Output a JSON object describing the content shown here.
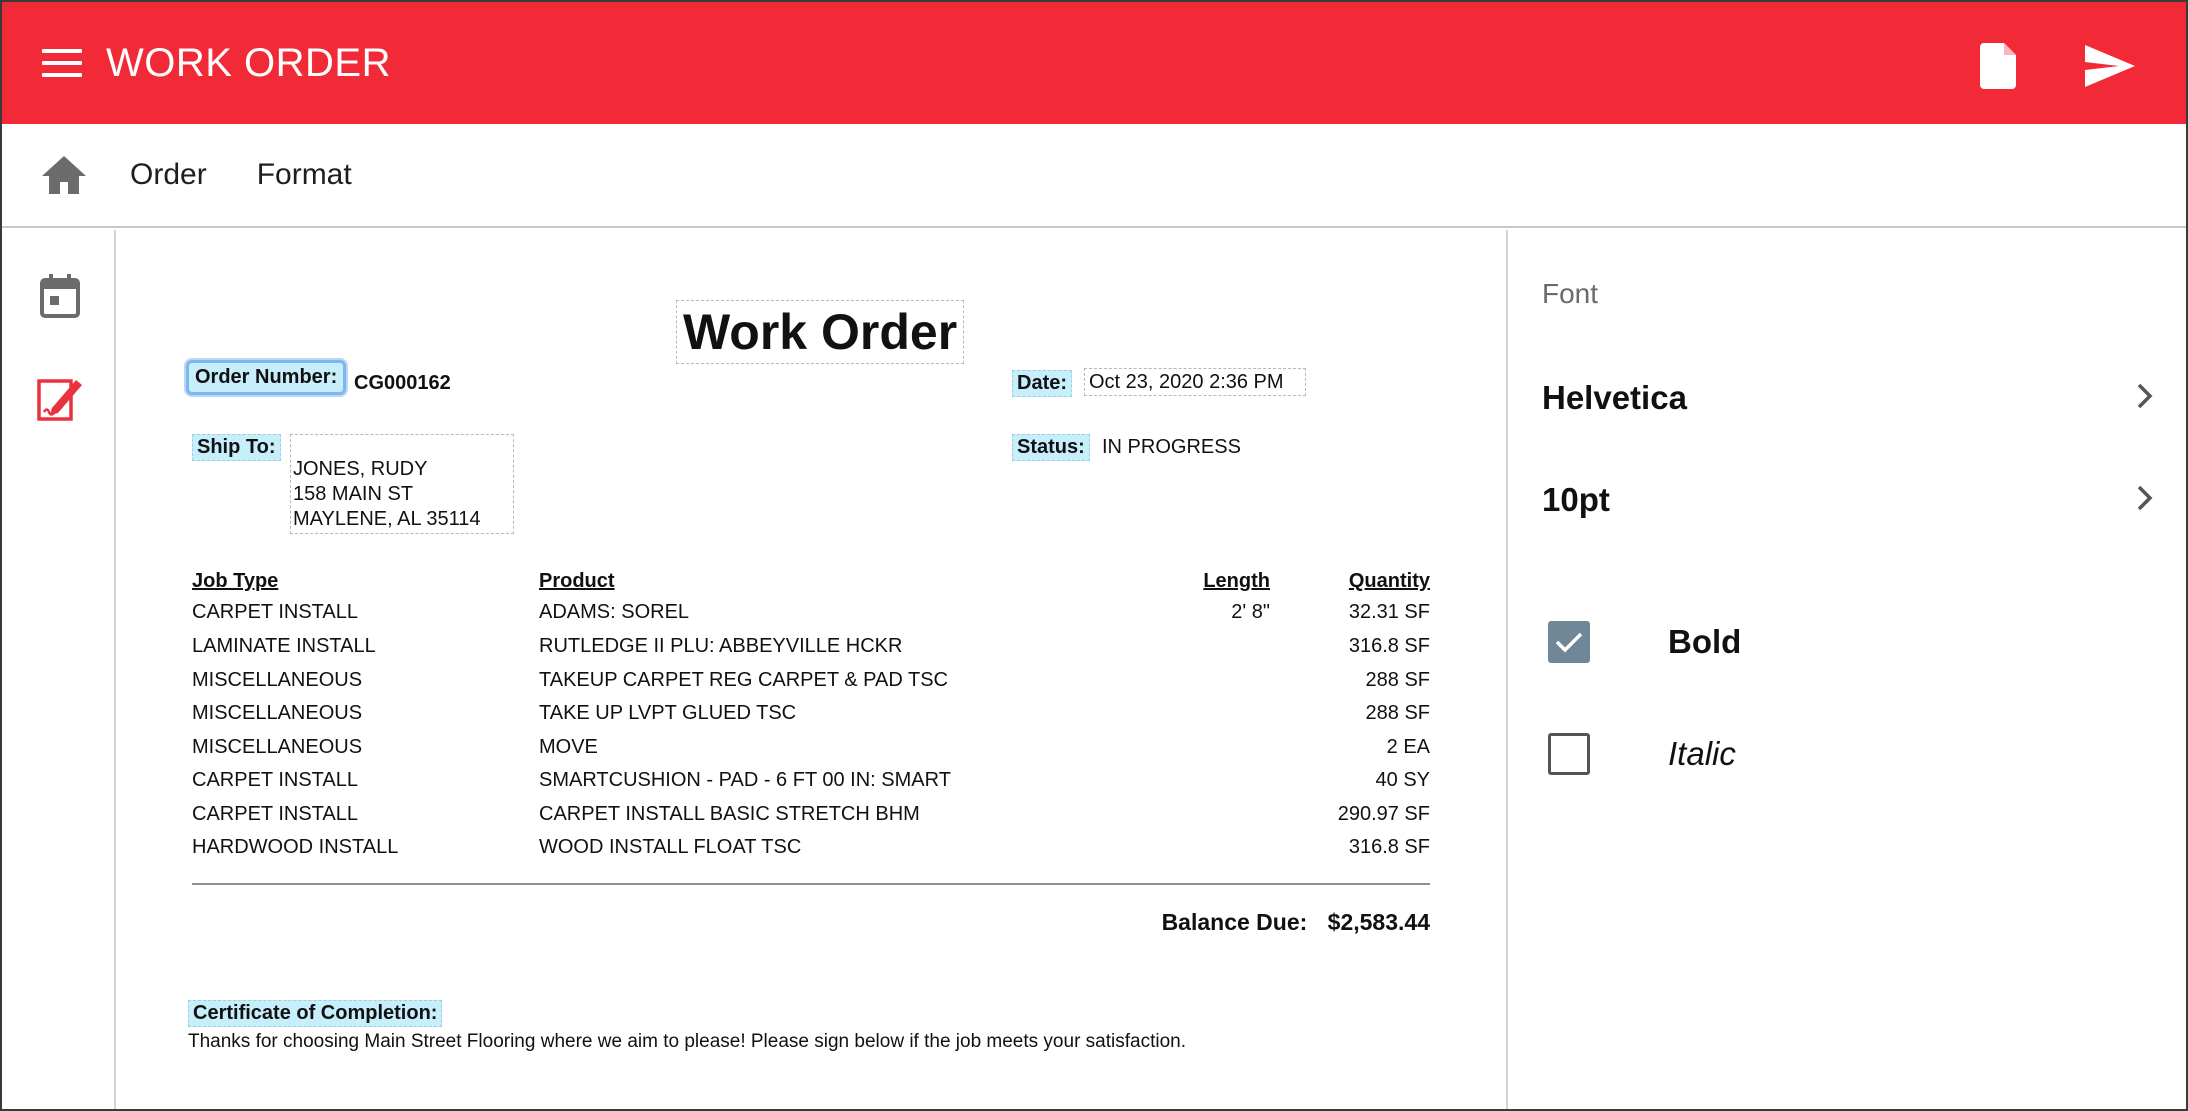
{
  "app": {
    "title": "WORK ORDER",
    "accent_color": "#f22a37",
    "menu_icon": "hamburger-menu-icon",
    "actions": [
      {
        "name": "document-icon"
      },
      {
        "name": "send-icon"
      }
    ]
  },
  "tabs": {
    "home_icon": "home-icon",
    "items": [
      "Order",
      "Format"
    ]
  },
  "rail": {
    "items": [
      {
        "icon": "calendar-icon",
        "active": false
      },
      {
        "icon": "edit-document-icon",
        "active": true
      }
    ]
  },
  "document": {
    "title": "Work Order",
    "order_number_label": "Order Number:",
    "order_number": "CG000162",
    "date_label": "Date:",
    "date": "Oct 23, 2020 2:36 PM",
    "ship_to_label": "Ship To:",
    "ship_to": {
      "name": "JONES, RUDY",
      "street": "158 MAIN ST",
      "city": "MAYLENE, AL 35114"
    },
    "status_label": "Status:",
    "status": "IN PROGRESS",
    "columns": {
      "job_type": "Job Type",
      "product": "Product",
      "length": "Length",
      "quantity": "Quantity"
    },
    "rows": [
      {
        "job_type": "CARPET INSTALL",
        "product": "ADAMS: SOREL",
        "length": "2' 8\"",
        "quantity": "32.31 SF"
      },
      {
        "job_type": "LAMINATE INSTALL",
        "product": "RUTLEDGE II PLU: ABBEYVILLE HCKR",
        "length": "",
        "quantity": "316.8 SF"
      },
      {
        "job_type": "MISCELLANEOUS",
        "product": "TAKEUP CARPET REG CARPET & PAD TSC",
        "length": "",
        "quantity": "288 SF"
      },
      {
        "job_type": "MISCELLANEOUS",
        "product": "TAKE UP LVPT GLUED TSC",
        "length": "",
        "quantity": "288 SF"
      },
      {
        "job_type": "MISCELLANEOUS",
        "product": "MOVE",
        "length": "",
        "quantity": "2 EA"
      },
      {
        "job_type": "CARPET INSTALL",
        "product": "SMARTCUSHION - PAD - 6 FT 00 IN: SMART",
        "length": "",
        "quantity": "40 SY"
      },
      {
        "job_type": "CARPET INSTALL",
        "product": "CARPET INSTALL BASIC STRETCH BHM",
        "length": "",
        "quantity": "290.97 SF"
      },
      {
        "job_type": "HARDWOOD INSTALL",
        "product": "WOOD INSTALL FLOAT TSC",
        "length": "",
        "quantity": "316.8 SF"
      }
    ],
    "balance_label": "Balance Due:",
    "balance": "$2,583.44",
    "certificate_label": "Certificate of Completion:",
    "certificate_text": "Thanks for choosing Main Street Flooring where we aim to please! Please sign below if the job meets your satisfaction."
  },
  "panel": {
    "label": "Font",
    "font_family": "Helvetica",
    "font_size": "10pt",
    "bold_label": "Bold",
    "bold_checked": true,
    "italic_label": "Italic",
    "italic_checked": false
  }
}
